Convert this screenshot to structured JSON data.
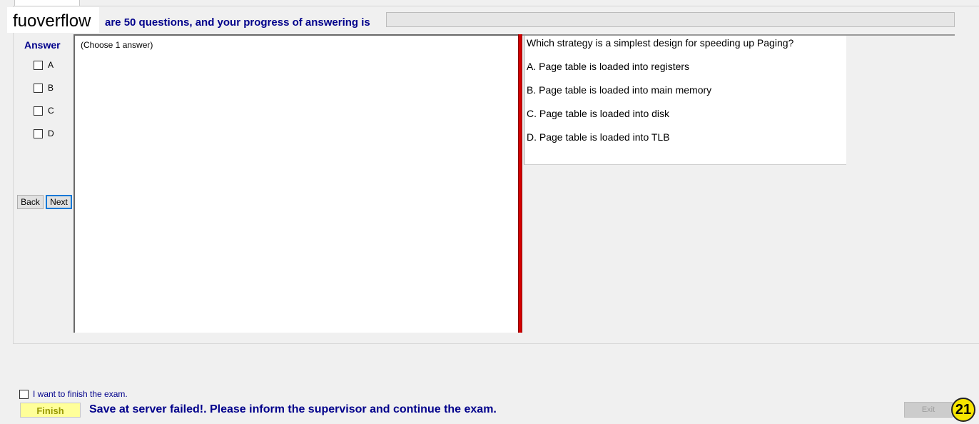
{
  "header": {
    "watermark": "fuoverflow",
    "progress_text": "are 50 questions, and your progress of answering is",
    "progress_percent": 0
  },
  "answer_panel": {
    "label": "Answer",
    "options": [
      "A",
      "B",
      "C",
      "D"
    ],
    "back_label": "Back",
    "next_label": "Next"
  },
  "content": {
    "instruction": "(Choose 1 answer)"
  },
  "question": {
    "text": "Which strategy is a simplest design for speeding up Paging?",
    "options": [
      "A.  Page table is loaded into registers",
      "B.  Page table is loaded into main memory",
      "C.  Page table is loaded into disk",
      "D.  Page table is loaded into TLB"
    ]
  },
  "footer": {
    "finish_checkbox_label": "I want to finish the exam.",
    "finish_label": "Finish",
    "status_message": "Save at server failed!. Please inform the supervisor and continue the exam.",
    "exit_label": "Exit",
    "counter": "21"
  },
  "colors": {
    "accent_text": "#00008b",
    "splitter": "#d40000",
    "finish_bg": "#ffff99",
    "badge": "#f7e600"
  }
}
